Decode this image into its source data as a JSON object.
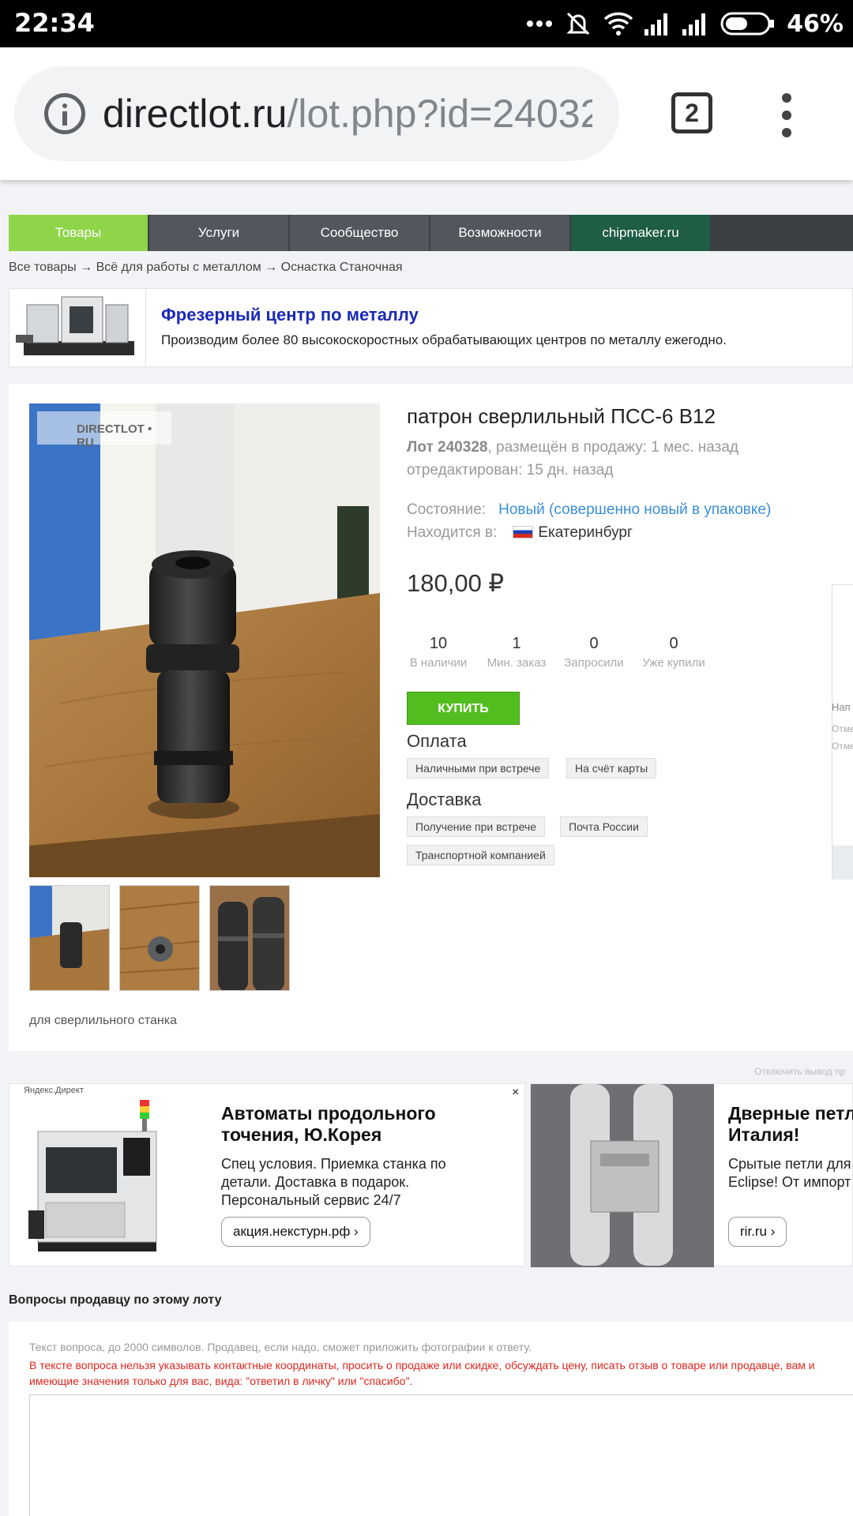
{
  "status_bar": {
    "time": "22:34",
    "battery": "46%"
  },
  "browser": {
    "url_host": "directlot.ru",
    "url_path": "/lot.php?id=24032",
    "tab_count": "2"
  },
  "nav": {
    "items": [
      "Товары",
      "Услуги",
      "Сообщество",
      "Возможности",
      "chipmaker.ru"
    ]
  },
  "breadcrumb": "Все товары → Всё для работы с металлом → Оснастка Станочная",
  "banner": {
    "title": "Фрезерный центр по металлу",
    "text": "Производим более 80 высокоскоростных обрабатывающих центров по металлу ежегодно."
  },
  "lot": {
    "watermark": "DIRECTLOT • RU",
    "title": "патрон сверлильный ПСС-6 В12",
    "lot_number": "Лот 240328",
    "posted": ", размещён в продажу: 1 мес. назад",
    "edited": "отредактирован: 15 дн. назад",
    "condition_label": "Состояние:",
    "condition": "Новый (совершенно новый в упаковке)",
    "location_label": "Находится в:",
    "location": "Екатеринбург",
    "price": "180,00 ₽",
    "stats": [
      {
        "value": "10",
        "label": "В наличии"
      },
      {
        "value": "1",
        "label": "Мин. заказ"
      },
      {
        "value": "0",
        "label": "Запросили"
      },
      {
        "value": "0",
        "label": "Уже купили"
      }
    ],
    "buy_label": "КУПИТЬ",
    "payment_heading": "Оплата",
    "payment": [
      "Наличными при встрече",
      "На счёт карты"
    ],
    "delivery_heading": "Доставка",
    "delivery": [
      "Получение при встрече",
      "Почта России",
      "Транспортной компанией"
    ],
    "description": "для сверлильного станка"
  },
  "side": {
    "t1": "Нап",
    "t2": "Отме",
    "t3": "Отме"
  },
  "ads": {
    "disable": "Отключить вывод пр",
    "label": "Яндекс.Директ",
    "ad1": {
      "title": "Автоматы продольного точения, Ю.Корея",
      "text": "Спец условия. Приемка станка по детали. Доставка в подарок. Персональный сервис 24/7",
      "link": "акция.некстурн.рф"
    },
    "ad2": {
      "title": "Дверные петл Италия!",
      "text": "Срытые петли для Eclipse! От импорт",
      "link": "rir.ru"
    },
    "close": "×"
  },
  "questions": {
    "heading": "Вопросы продавцу по этому лоту",
    "hint": "Текст вопроса, до 2000 символов. Продавец, если надо, сможет приложить фотографии к ответу.",
    "warning": "В тексте вопроса нельзя указывать контактные координаты, просить о продаже или скидке, обсуждать цену, писать отзыв о товаре или продавце, вам и имеющие значения только для вас, вида: \"ответил в личку\" или \"спасибо\"."
  }
}
